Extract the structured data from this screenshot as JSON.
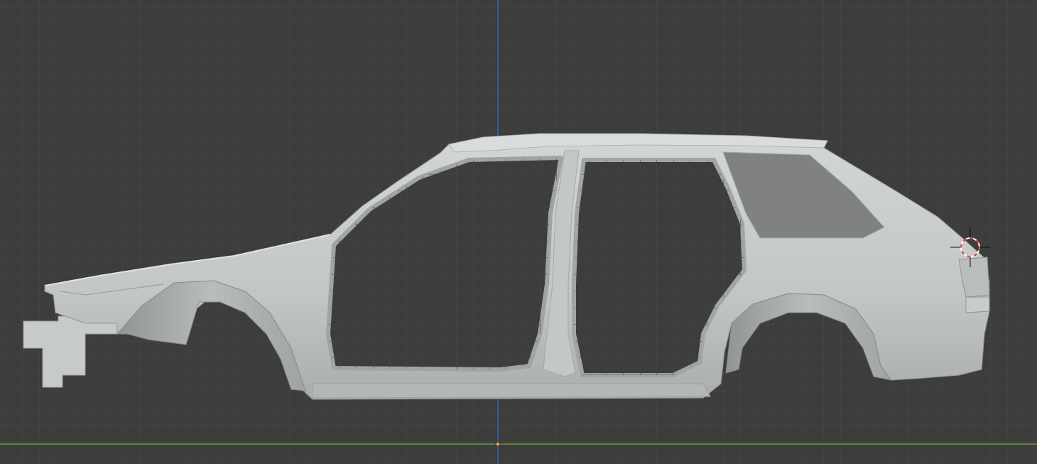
{
  "viewport": {
    "mode": "side-orthographic-view",
    "object": "car-body-shell",
    "colors": {
      "background": "#3d3d3d",
      "grid_minor": "#474747",
      "grid_major": "#505050",
      "z_axis": "#2f67b3",
      "y_axis": "#6a9f2c",
      "origin": "#f0a23a",
      "body_light": "#c9cdcd",
      "body_mid": "#b5b9b9",
      "body_dark": "#8e9393",
      "glass": "#7d7f7f",
      "cursor_red": "#d83c3c"
    },
    "icons": {
      "cursor": "3d-cursor-icon",
      "origin": "origin-point-icon"
    }
  }
}
